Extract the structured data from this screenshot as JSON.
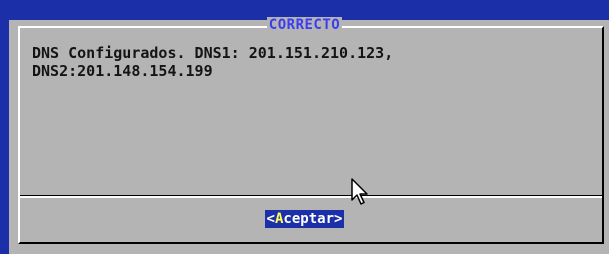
{
  "dialog": {
    "title": "CORRECTO",
    "message": "DNS Configurados. DNS1: 201.151.210.123,\nDNS2:201.148.154.199",
    "button": {
      "bracket_open": "<",
      "hotkey": "A",
      "rest": "ceptar",
      "bracket_close": ">"
    }
  },
  "colors": {
    "backdrop": "#1b2fa8",
    "dialog_bg": "#b4b4b4",
    "title": "#3c3cf0",
    "button_bg": "#1b2fa8",
    "button_hotkey": "#ffff54"
  },
  "icons": {
    "pointer": "mouse-pointer-icon"
  }
}
